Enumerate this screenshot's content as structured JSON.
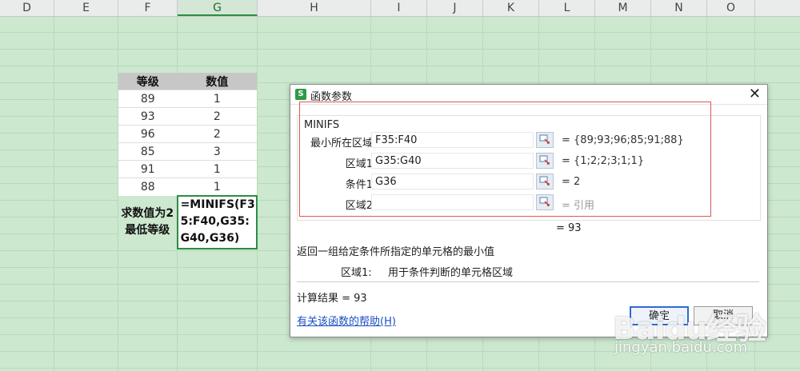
{
  "sheet": {
    "columns": [
      "D",
      "E",
      "F",
      "G",
      "H",
      "I",
      "J",
      "K",
      "L",
      "M",
      "N",
      "O"
    ],
    "active_column": "G",
    "table": {
      "headers": [
        "等级",
        "数值"
      ],
      "rows": [
        [
          "89",
          "1"
        ],
        [
          "93",
          "2"
        ],
        [
          "96",
          "2"
        ],
        [
          "85",
          "3"
        ],
        [
          "91",
          "1"
        ],
        [
          "88",
          "1"
        ]
      ],
      "label": "求数值为2最低等级",
      "formula": "=MINIFS(F35:F40,G35:G40,G36)"
    }
  },
  "dialog": {
    "title": "函数参数",
    "function_name": "MINIFS",
    "args": [
      {
        "label": "最小所在区域",
        "input": "F35:F40",
        "value": "= {89;93;96;85;91;88}"
      },
      {
        "label": "区域1",
        "input": "G35:G40",
        "value": "= {1;2;2;3;1;1}"
      },
      {
        "label": "条件1",
        "input": "G36",
        "value": "= 2"
      },
      {
        "label": "区域2",
        "input": "",
        "value": "= 引用"
      }
    ],
    "inline_result": "= 93",
    "description": "返回一组给定条件所指定的单元格的最小值",
    "arg_desc_label": "区域1:",
    "arg_desc_text": "用于条件判断的单元格区域",
    "calc_result": "计算结果 = 93",
    "help_link": "有关该函数的帮助(H)",
    "ok_label": "确定",
    "cancel_label": "取消"
  },
  "watermark": {
    "logo": "Baidu经验",
    "url": "jingyan.baidu.com"
  }
}
